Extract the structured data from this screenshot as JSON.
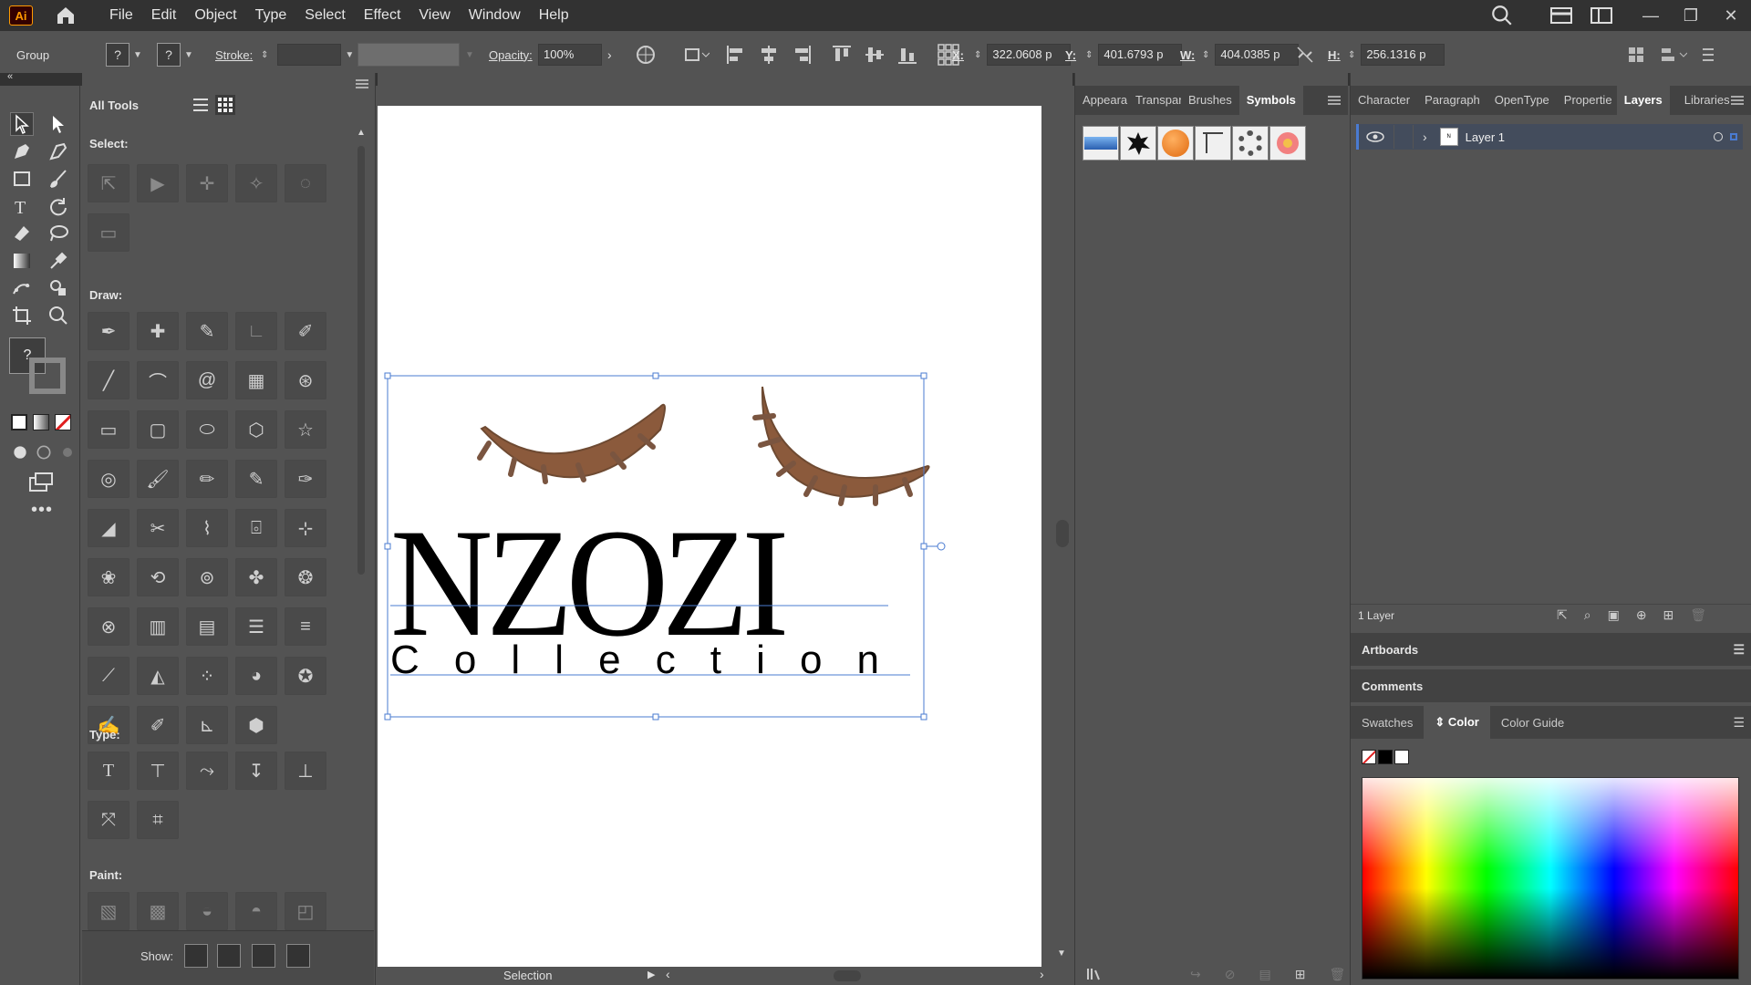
{
  "app": {
    "logo": "Ai"
  },
  "menu": [
    "File",
    "Edit",
    "Object",
    "Type",
    "Select",
    "Effect",
    "View",
    "Window",
    "Help"
  ],
  "control": {
    "selection_type": "Group",
    "stroke_label": "Stroke:",
    "opacity_label": "Opacity:",
    "opacity_value": "100%",
    "x_label": "X:",
    "x_value": "322.0608 p",
    "y_label": "Y:",
    "y_value": "401.6793 p",
    "w_label": "W:",
    "w_value": "404.0385 p",
    "h_label": "H:",
    "h_value": "256.1316 p",
    "q1": "?",
    "q2": "?"
  },
  "toolbar": {
    "q": "?"
  },
  "alltools": {
    "title": "All Tools",
    "select_label": "Select:",
    "draw_label": "Draw:",
    "type_label": "Type:",
    "paint_label": "Paint:",
    "show_label": "Show:"
  },
  "canvas": {
    "brand_text": "NZOZI",
    "sub_text": "Collection",
    "eye_color": "#8b5a3c",
    "selection_color": "#4a7bd1"
  },
  "status": {
    "tool": "Selection"
  },
  "panel_symbols": {
    "tabs": [
      "Appeara",
      "Transpar",
      "Brushes",
      "Symbols"
    ],
    "active": "Symbols"
  },
  "panel_layers": {
    "tabs": [
      "Character",
      "Paragraph",
      "OpenType",
      "Propertie",
      "Layers",
      "Libraries"
    ],
    "active": "Layers",
    "layer_name": "Layer 1",
    "layer_count": "1 Layer",
    "artboards": "Artboards",
    "comments": "Comments",
    "color_tabs": [
      "Swatches",
      "Color",
      "Color Guide"
    ],
    "color_active": "Color"
  }
}
